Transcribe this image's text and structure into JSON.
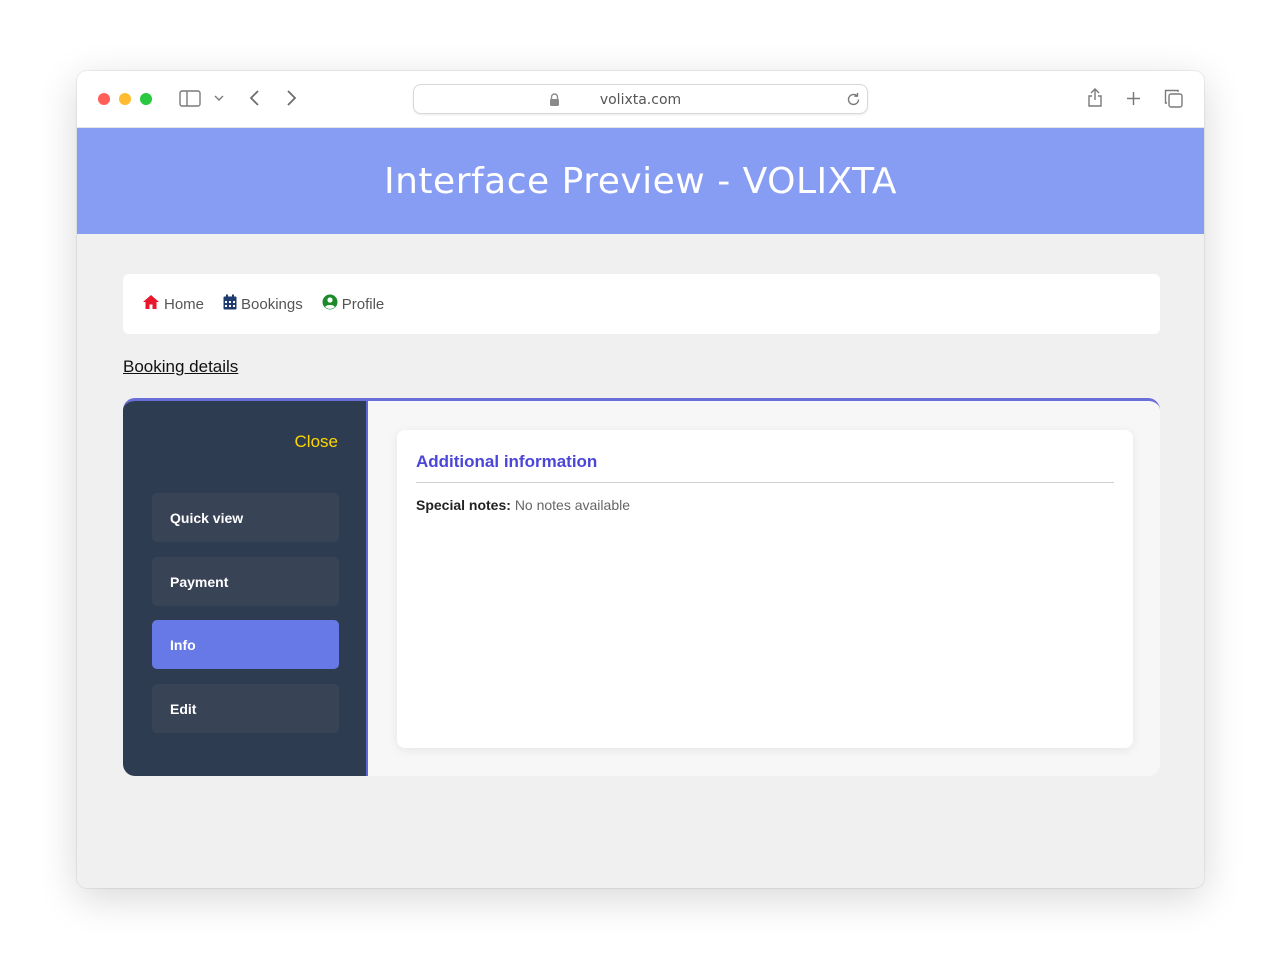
{
  "browser": {
    "url": "volixta.com"
  },
  "banner": {
    "title": "Interface Preview - VOLIXTA"
  },
  "nav": {
    "items": [
      {
        "label": "Home",
        "icon": "home-icon",
        "color": "#e8192c"
      },
      {
        "label": "Bookings",
        "icon": "calendar-icon",
        "color": "#1f3a6e"
      },
      {
        "label": "Profile",
        "icon": "user-circle-icon",
        "color": "#1d8a2a"
      }
    ]
  },
  "section": {
    "link": "Booking details"
  },
  "sidebar": {
    "close_label": "Close",
    "items": [
      {
        "label": "Quick view",
        "active": false
      },
      {
        "label": "Payment",
        "active": false
      },
      {
        "label": "Info",
        "active": true
      },
      {
        "label": "Edit",
        "active": false
      }
    ]
  },
  "content": {
    "title": "Additional information",
    "notes_label": "Special notes:",
    "notes_value": "No notes available"
  },
  "colors": {
    "banner": "#879cf3",
    "sidebar": "#2e3c51",
    "active_tab": "#6779e6",
    "close": "#ffd700",
    "heading": "#4b46d8"
  }
}
